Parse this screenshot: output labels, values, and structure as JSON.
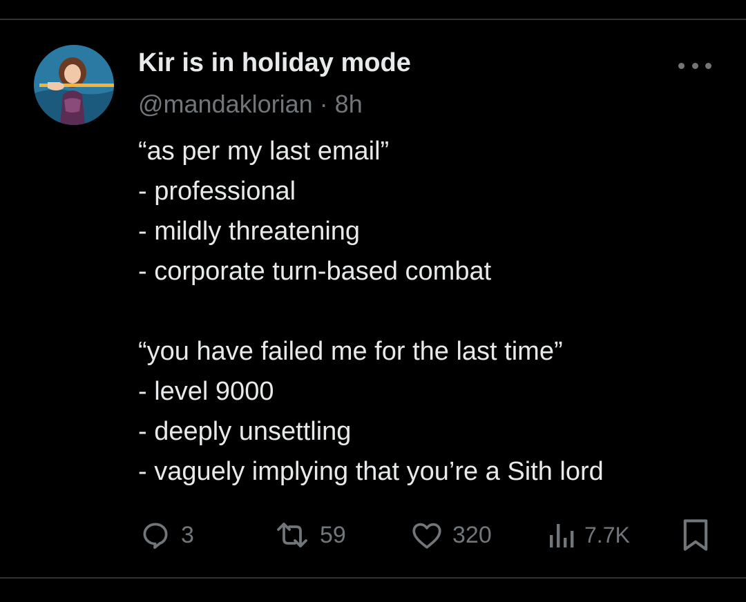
{
  "tweet": {
    "author_name": "Kir is in holiday mode",
    "handle": "@mandaklorian",
    "separator": " · ",
    "time": "8h",
    "body_lines": [
      "“as per my last email”",
      "- professional",
      "- mildly threatening",
      "- corporate turn-based combat",
      "",
      "“you have failed me for the last time”",
      "- level 9000",
      "- deeply unsettling",
      "- vaguely implying that you’re a Sith lord"
    ]
  },
  "actions": {
    "reply_count": "3",
    "retweet_count": "59",
    "like_count": "320",
    "view_count": "7.7K"
  },
  "icons": {
    "reply": "reply-icon",
    "retweet": "retweet-icon",
    "like": "heart-icon",
    "views": "views-icon",
    "bookmark": "bookmark-icon",
    "more": "more-icon"
  },
  "colors": {
    "background": "#000000",
    "text": "#e7e9ea",
    "secondary": "#71767b",
    "divider": "#2f3336"
  }
}
